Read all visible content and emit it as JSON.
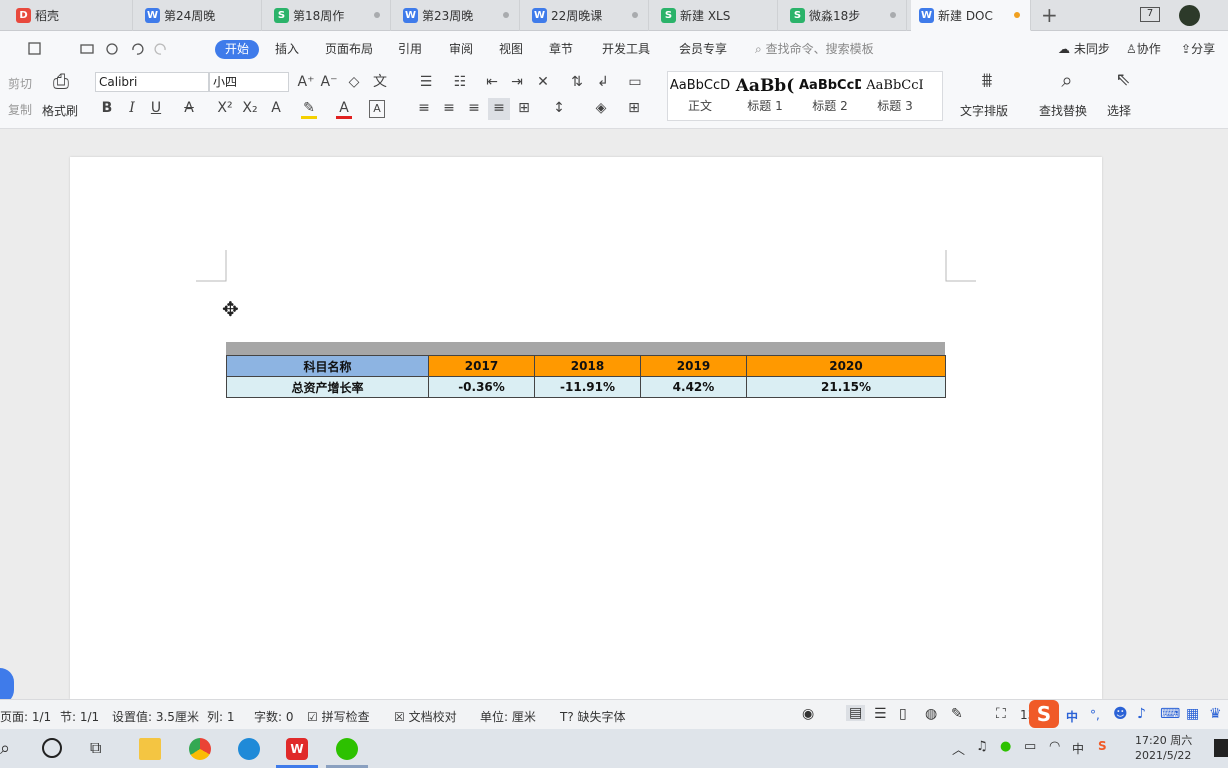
{
  "tabs": [
    {
      "label": "稻壳",
      "icon": "D",
      "color": "#e8493d"
    },
    {
      "label": "第24周晚",
      "icon": "W",
      "color": "#3f7bea"
    },
    {
      "label": "第18周作",
      "icon": "S",
      "color": "#2bb36a"
    },
    {
      "label": "第23周晚",
      "icon": "W",
      "color": "#3f7bea"
    },
    {
      "label": "22周晚课",
      "icon": "W",
      "color": "#3f7bea"
    },
    {
      "label": "新建 XLS",
      "icon": "S",
      "color": "#2bb36a"
    },
    {
      "label": "微淼18步",
      "icon": "S",
      "color": "#2bb36a"
    },
    {
      "label": "新建 DOC",
      "icon": "W",
      "color": "#3f7bea"
    }
  ],
  "tab_plus": "+",
  "menu": {
    "items": [
      "开始",
      "插入",
      "页面布局",
      "引用",
      "审阅",
      "视图",
      "章节",
      "开发工具",
      "会员专享"
    ],
    "search": "查找命令、搜索模板",
    "sync": "未同步",
    "collab": "协作",
    "share": "分享"
  },
  "ribbon": {
    "cut": "剪切",
    "copy": "复制",
    "format_painter": "格式刷",
    "font": "Calibri",
    "size": "小四",
    "styles": [
      {
        "preview": "AaBbCcD",
        "label": "正文"
      },
      {
        "preview": "AaBb(",
        "label": "标题 1"
      },
      {
        "preview": "AaBbCcDc",
        "label": "标题 2"
      },
      {
        "preview": "AaBbCcI",
        "label": "标题 3"
      }
    ],
    "text_layout": "文字排版",
    "find_replace": "查找替换",
    "select": "选择"
  },
  "table": {
    "header": [
      "科目名称",
      "2017",
      "2018",
      "2019",
      "2020"
    ],
    "row": [
      "总资产增长率",
      "-0.36%",
      "-11.91%",
      "4.42%",
      "21.15%"
    ]
  },
  "status": {
    "page": "页面: 1/1",
    "section": "节: 1/1",
    "setting": "设置值: 3.5厘米",
    "col": "列: 1",
    "words": "字数: 0",
    "spell": "拼写检查",
    "doc_check": "文档校对",
    "unit": "单位: 厘米",
    "missing_font": "缺失字体",
    "zoom": "13"
  },
  "ime": "中",
  "clock": {
    "time": "17:20 周六",
    "date": "2021/5/22"
  },
  "colors": {
    "accent": "#3f7bea",
    "header_blue": "#8db4e2",
    "header_orange": "#ff9900",
    "row_bg": "#daeef3",
    "gray_bar": "#a6a6a6"
  }
}
